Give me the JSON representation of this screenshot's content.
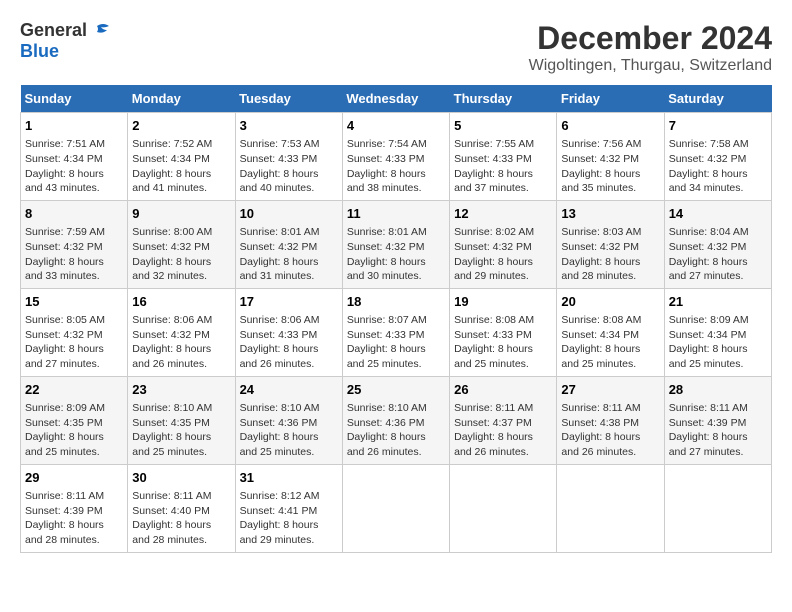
{
  "logo": {
    "general": "General",
    "blue": "Blue"
  },
  "title": "December 2024",
  "subtitle": "Wigoltingen, Thurgau, Switzerland",
  "weekdays": [
    "Sunday",
    "Monday",
    "Tuesday",
    "Wednesday",
    "Thursday",
    "Friday",
    "Saturday"
  ],
  "weeks": [
    [
      {
        "day": "1",
        "sunrise": "7:51 AM",
        "sunset": "4:34 PM",
        "daylight": "8 hours and 43 minutes."
      },
      {
        "day": "2",
        "sunrise": "7:52 AM",
        "sunset": "4:34 PM",
        "daylight": "8 hours and 41 minutes."
      },
      {
        "day": "3",
        "sunrise": "7:53 AM",
        "sunset": "4:33 PM",
        "daylight": "8 hours and 40 minutes."
      },
      {
        "day": "4",
        "sunrise": "7:54 AM",
        "sunset": "4:33 PM",
        "daylight": "8 hours and 38 minutes."
      },
      {
        "day": "5",
        "sunrise": "7:55 AM",
        "sunset": "4:33 PM",
        "daylight": "8 hours and 37 minutes."
      },
      {
        "day": "6",
        "sunrise": "7:56 AM",
        "sunset": "4:32 PM",
        "daylight": "8 hours and 35 minutes."
      },
      {
        "day": "7",
        "sunrise": "7:58 AM",
        "sunset": "4:32 PM",
        "daylight": "8 hours and 34 minutes."
      }
    ],
    [
      {
        "day": "8",
        "sunrise": "7:59 AM",
        "sunset": "4:32 PM",
        "daylight": "8 hours and 33 minutes."
      },
      {
        "day": "9",
        "sunrise": "8:00 AM",
        "sunset": "4:32 PM",
        "daylight": "8 hours and 32 minutes."
      },
      {
        "day": "10",
        "sunrise": "8:01 AM",
        "sunset": "4:32 PM",
        "daylight": "8 hours and 31 minutes."
      },
      {
        "day": "11",
        "sunrise": "8:01 AM",
        "sunset": "4:32 PM",
        "daylight": "8 hours and 30 minutes."
      },
      {
        "day": "12",
        "sunrise": "8:02 AM",
        "sunset": "4:32 PM",
        "daylight": "8 hours and 29 minutes."
      },
      {
        "day": "13",
        "sunrise": "8:03 AM",
        "sunset": "4:32 PM",
        "daylight": "8 hours and 28 minutes."
      },
      {
        "day": "14",
        "sunrise": "8:04 AM",
        "sunset": "4:32 PM",
        "daylight": "8 hours and 27 minutes."
      }
    ],
    [
      {
        "day": "15",
        "sunrise": "8:05 AM",
        "sunset": "4:32 PM",
        "daylight": "8 hours and 27 minutes."
      },
      {
        "day": "16",
        "sunrise": "8:06 AM",
        "sunset": "4:32 PM",
        "daylight": "8 hours and 26 minutes."
      },
      {
        "day": "17",
        "sunrise": "8:06 AM",
        "sunset": "4:33 PM",
        "daylight": "8 hours and 26 minutes."
      },
      {
        "day": "18",
        "sunrise": "8:07 AM",
        "sunset": "4:33 PM",
        "daylight": "8 hours and 25 minutes."
      },
      {
        "day": "19",
        "sunrise": "8:08 AM",
        "sunset": "4:33 PM",
        "daylight": "8 hours and 25 minutes."
      },
      {
        "day": "20",
        "sunrise": "8:08 AM",
        "sunset": "4:34 PM",
        "daylight": "8 hours and 25 minutes."
      },
      {
        "day": "21",
        "sunrise": "8:09 AM",
        "sunset": "4:34 PM",
        "daylight": "8 hours and 25 minutes."
      }
    ],
    [
      {
        "day": "22",
        "sunrise": "8:09 AM",
        "sunset": "4:35 PM",
        "daylight": "8 hours and 25 minutes."
      },
      {
        "day": "23",
        "sunrise": "8:10 AM",
        "sunset": "4:35 PM",
        "daylight": "8 hours and 25 minutes."
      },
      {
        "day": "24",
        "sunrise": "8:10 AM",
        "sunset": "4:36 PM",
        "daylight": "8 hours and 25 minutes."
      },
      {
        "day": "25",
        "sunrise": "8:10 AM",
        "sunset": "4:36 PM",
        "daylight": "8 hours and 26 minutes."
      },
      {
        "day": "26",
        "sunrise": "8:11 AM",
        "sunset": "4:37 PM",
        "daylight": "8 hours and 26 minutes."
      },
      {
        "day": "27",
        "sunrise": "8:11 AM",
        "sunset": "4:38 PM",
        "daylight": "8 hours and 26 minutes."
      },
      {
        "day": "28",
        "sunrise": "8:11 AM",
        "sunset": "4:39 PM",
        "daylight": "8 hours and 27 minutes."
      }
    ],
    [
      {
        "day": "29",
        "sunrise": "8:11 AM",
        "sunset": "4:39 PM",
        "daylight": "8 hours and 28 minutes."
      },
      {
        "day": "30",
        "sunrise": "8:11 AM",
        "sunset": "4:40 PM",
        "daylight": "8 hours and 28 minutes."
      },
      {
        "day": "31",
        "sunrise": "8:12 AM",
        "sunset": "4:41 PM",
        "daylight": "8 hours and 29 minutes."
      },
      null,
      null,
      null,
      null
    ]
  ]
}
